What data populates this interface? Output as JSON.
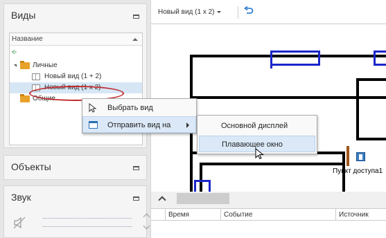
{
  "left_panel": {
    "views": {
      "title": "Виды",
      "column_header": "Название",
      "toolbar_icon": "tree-toggle-icon",
      "tree": [
        {
          "label": "Личные",
          "type": "folder",
          "expanded": true
        },
        {
          "label": "Новый вид (1 + 2)",
          "type": "view"
        },
        {
          "label": "Новый вид (1 x 2)",
          "type": "view",
          "selected": true
        },
        {
          "label": "Общие",
          "type": "folder",
          "expanded": false
        }
      ]
    },
    "objects": {
      "title": "Объекты"
    },
    "sound": {
      "title": "Звук",
      "mute_icon": "speaker-muted-icon"
    }
  },
  "right_panel": {
    "view_tab": "Новый вид (1 x 2)",
    "undo_icon": "undo-icon",
    "access_point_label": "Пункт доступа1",
    "log_columns": [
      "Время",
      "Событие",
      "Источник"
    ]
  },
  "context_menu": {
    "items": [
      {
        "label": "Выбрать вид",
        "icon": "cursor-select-icon"
      },
      {
        "label": "Отправить вид на",
        "icon": "window-icon",
        "has_submenu": true
      }
    ]
  },
  "submenu": {
    "items": [
      {
        "label": "Основной дисплей"
      },
      {
        "label": "Плавающее окно",
        "highlighted": true
      }
    ]
  },
  "colors": {
    "wall": "#000000",
    "door": "#1a25c8",
    "folder": "#e8a12a",
    "highlight_ellipse": "#c0282d",
    "menu_highlight": "#dbe8f7"
  }
}
